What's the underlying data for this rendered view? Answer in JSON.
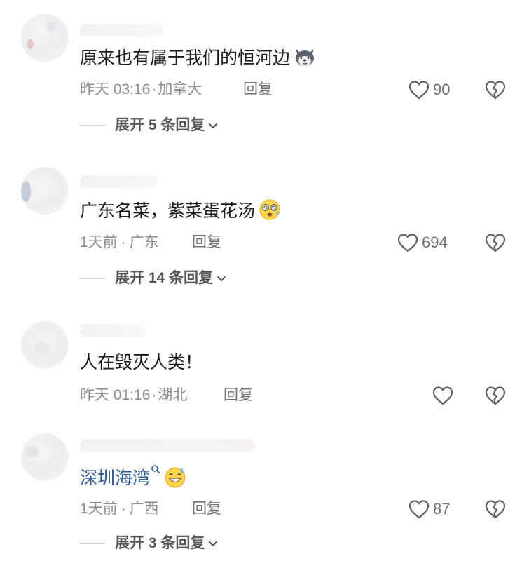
{
  "comments": [
    {
      "username": "",
      "text": "原来也有属于我们的恒河边",
      "time": "昨天 03:16",
      "location": "加拿大",
      "reply_label": "回复",
      "likes": "90",
      "expand_label": "展开 5 条回复",
      "emoji": "wolf-face-emoji"
    },
    {
      "username": "",
      "text": "广东名菜，紫菜蛋花汤",
      "time": "1天前",
      "location": "广东",
      "reply_label": "回复",
      "likes": "694",
      "expand_label": "展开 14 条回复",
      "emoji": "dizzy-face-emoji"
    },
    {
      "username": "",
      "text": "人在毁灭人类！",
      "time": "昨天 01:16",
      "location": "湖北",
      "reply_label": "回复",
      "likes": "",
      "expand_label": ""
    },
    {
      "username": "",
      "text": "深圳海湾",
      "time": "1天前",
      "location": "广西",
      "reply_label": "回复",
      "likes": "87",
      "expand_label": "展开 3 条回复",
      "emoji": "grinning-sweat-emoji",
      "link_color": "#2b5797"
    }
  ],
  "meta_separator": "·",
  "icons": {
    "like": "heart-outline-icon",
    "dislike": "broken-heart-icon",
    "expand": "chevron-down-icon",
    "search": "search-icon"
  },
  "colors": {
    "text": "#161823",
    "meta": "#8a8b91",
    "secondary": "#6f7077",
    "link": "#2b5797",
    "divider": "#d4d5d8"
  }
}
